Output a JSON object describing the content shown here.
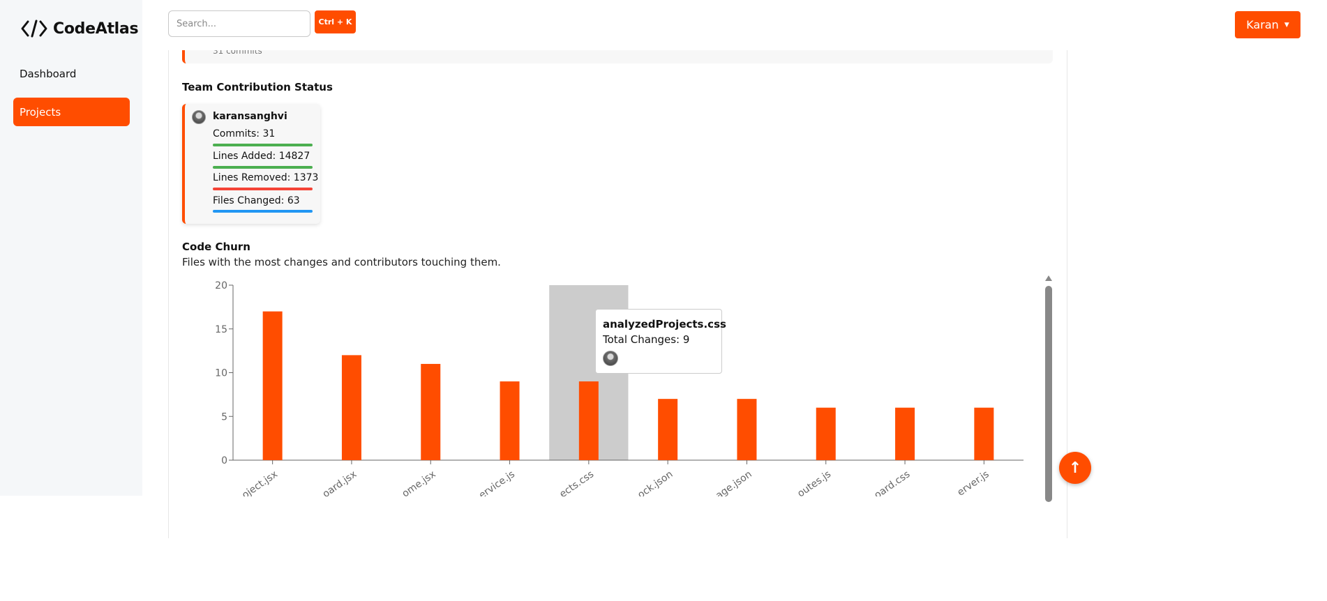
{
  "app": {
    "name": "CodeAtlas"
  },
  "sidebar": {
    "items": [
      {
        "label": "Dashboard"
      },
      {
        "label": "Projects",
        "active": true
      }
    ]
  },
  "topbar": {
    "search_placeholder": "Search...",
    "shortcut_label": "Ctrl + K",
    "user_label": "Karan",
    "user_caret": "▼"
  },
  "previous_card": {
    "text": "31 commits"
  },
  "team": {
    "title": "Team Contribution Status",
    "contributors": [
      {
        "username": "karansanghvi",
        "commits_label": "Commits: 31",
        "lines_added_label": "Lines Added: 14827",
        "lines_removed_label": "Lines Removed: 1373",
        "files_changed_label": "Files Changed: 63"
      }
    ],
    "colors": {
      "commits": "#4caf50",
      "added": "#4caf50",
      "removed": "#f44336",
      "files": "#2196f3"
    }
  },
  "churn": {
    "title": "Code Churn",
    "subtitle": "Files with the most changes and contributors touching them.",
    "tooltip": {
      "file": "analyzedProjects.css",
      "total_label": "Total Changes: 9"
    },
    "fab_label": "↑"
  },
  "chart_data": {
    "type": "bar",
    "categories": [
      "project.jsx",
      "board.jsx",
      "Home.jsx",
      "service.js",
      "analyzedProjects.css",
      "lock.json",
      "package.json",
      "routes.js",
      "board.css",
      "server.js"
    ],
    "tick_labels": [
      "oject.jsx",
      "oard.jsx",
      "ome.jsx",
      "ervice.js",
      "ects.css",
      "ock.json",
      "age.json",
      "outes.js",
      "oard.css",
      "erver.js"
    ],
    "values": [
      17,
      12,
      11,
      9,
      9,
      7,
      7,
      6,
      6,
      6
    ],
    "ylim": [
      0,
      20
    ],
    "yticks": [
      0,
      5,
      10,
      15,
      20
    ],
    "highlighted_index": 4,
    "bar_color": "#ff4d00",
    "highlight_color": "#cccccc",
    "grid": false
  }
}
